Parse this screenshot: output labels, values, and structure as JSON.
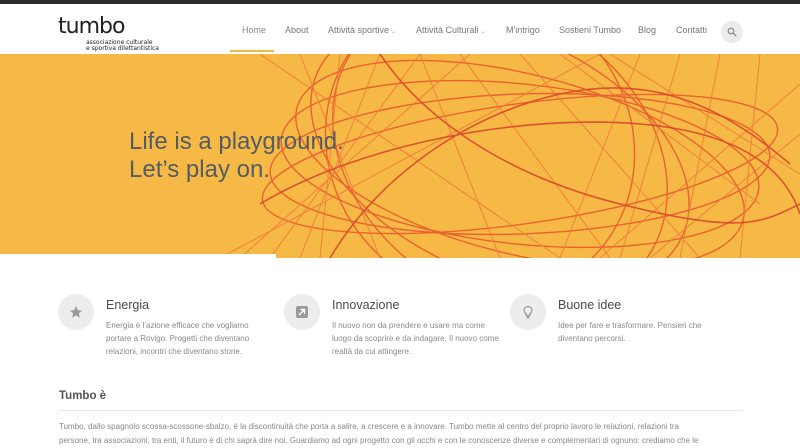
{
  "brand": {
    "logo_text": "tumbo",
    "tagline_line1": "associazione culturale",
    "tagline_line2": "e sportiva dilettantistica"
  },
  "nav": {
    "items": [
      {
        "label": "Home",
        "active": true,
        "dropdown": false
      },
      {
        "label": "About",
        "active": false,
        "dropdown": false
      },
      {
        "label": "Attività sportive",
        "active": false,
        "dropdown": true
      },
      {
        "label": "Attività Culturali",
        "active": false,
        "dropdown": true
      },
      {
        "label": "M'intrigo",
        "active": false,
        "dropdown": false
      },
      {
        "label": "Sostieni Tumbo",
        "active": false,
        "dropdown": false
      },
      {
        "label": "Blog",
        "active": false,
        "dropdown": false
      },
      {
        "label": "Contatti",
        "active": false,
        "dropdown": false
      }
    ],
    "search_icon": "search-icon",
    "chevron_glyph": "⌄"
  },
  "hero": {
    "line1": "Life is a playground.",
    "line2": "Let’s play on.",
    "background_color": "#f6b945",
    "line_color": "#e8532c"
  },
  "features": [
    {
      "icon": "star-icon",
      "title": "Energia",
      "description": "Energia è l’azione efficace che vogliamo portare a Rovigo. Progetti che diventano relazioni, incontri che diventano storie."
    },
    {
      "icon": "arrow-up-right-icon",
      "title": "Innovazione",
      "description": "Il nuovo non da prendere e usare ma come luogo da scoprire e da indagare. Il nuovo come realtà da cui attingere."
    },
    {
      "icon": "lightbulb-icon",
      "title": "Buone idee",
      "description": "Idee per fare e trasformare. Pensieri che diventano percorsi."
    }
  ],
  "about": {
    "title": "Tumbo è",
    "line1": "Tumbo, dallo spagnolo scossa-scossone-sbalzo, è la discontinuità che porta a salire, a crescere e a innovare. Tumbo mette al centro del proprio lavoro le relazioni, relazioni tra",
    "line2": "persone, tra associazioni, tra enti, il futuro è di chi saprà dire noi. Guardiamo ad ogni progetto con gli occhi e con le conoscenze diverse e complementari di ognuno: crediamo che le"
  },
  "colors": {
    "accent": "#f5b943",
    "text_dark": "#4a4a4a",
    "text_muted": "#8a8a8a"
  }
}
